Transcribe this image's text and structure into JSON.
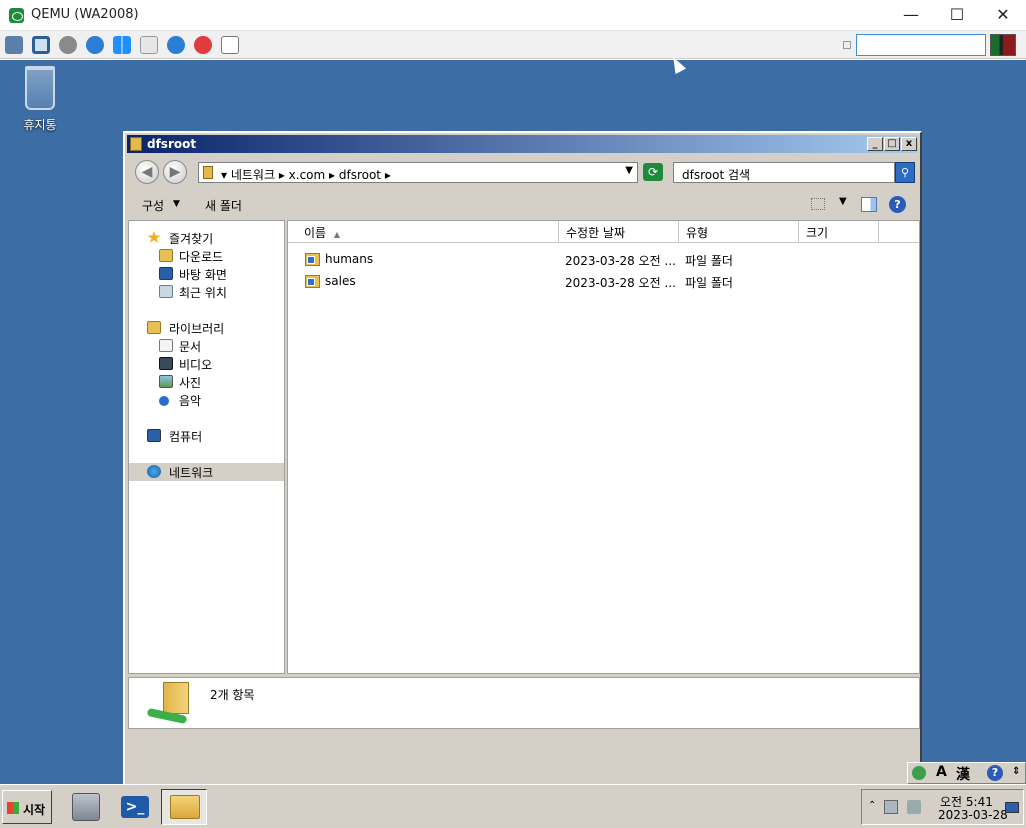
{
  "host": {
    "title": "QEMU (WA2008)",
    "controls": {
      "minimize": "—",
      "maximize": "☐",
      "close": "✕"
    }
  },
  "desktop": {
    "recycle_bin_label": "휴지통"
  },
  "explorer": {
    "title": "dfsroot",
    "caption_buttons": {
      "minimize": "_",
      "maximize": "□",
      "close": "x"
    },
    "address": {
      "crumbs": "▾  네트워크  ▸  x.com  ▸  dfsroot  ▸",
      "dropdown": "▼"
    },
    "search": {
      "value": "dfsroot 검색"
    },
    "command_bar": {
      "organize": "구성",
      "organize_arrow": "▼",
      "new_folder": "새 폴더",
      "view_arrow": "▼",
      "help": "?"
    },
    "navigation": {
      "favorites": "즐겨찾기",
      "downloads": "다운로드",
      "desktop": "바탕 화면",
      "recent": "최근 위치",
      "libraries": "라이브러리",
      "documents": "문서",
      "videos": "비디오",
      "pictures": "사진",
      "music": "음악",
      "computer": "컴퓨터",
      "network": "네트워크"
    },
    "columns": {
      "name": "이름",
      "name_sort": "▲",
      "modified": "수정한 날짜",
      "type": "유형",
      "size": "크기"
    },
    "files": [
      {
        "name": "humans",
        "modified": "2023-03-28 오전 ...",
        "type": "파일 폴더"
      },
      {
        "name": "sales",
        "modified": "2023-03-28 오전 ...",
        "type": "파일 폴더"
      }
    ],
    "details": {
      "item_count": "2개 항목"
    }
  },
  "langbar": {
    "input_mode": "A",
    "hanja": "漢",
    "help": "?"
  },
  "taskbar": {
    "start_label": "시작",
    "clock_time": "오전 5:41",
    "clock_date": "2023-03-28"
  },
  "colors": {
    "desktop": "#3c6da4",
    "titlebar_start": "#0a246a",
    "titlebar_end": "#a6caf0",
    "chrome": "#d4d0c8"
  }
}
